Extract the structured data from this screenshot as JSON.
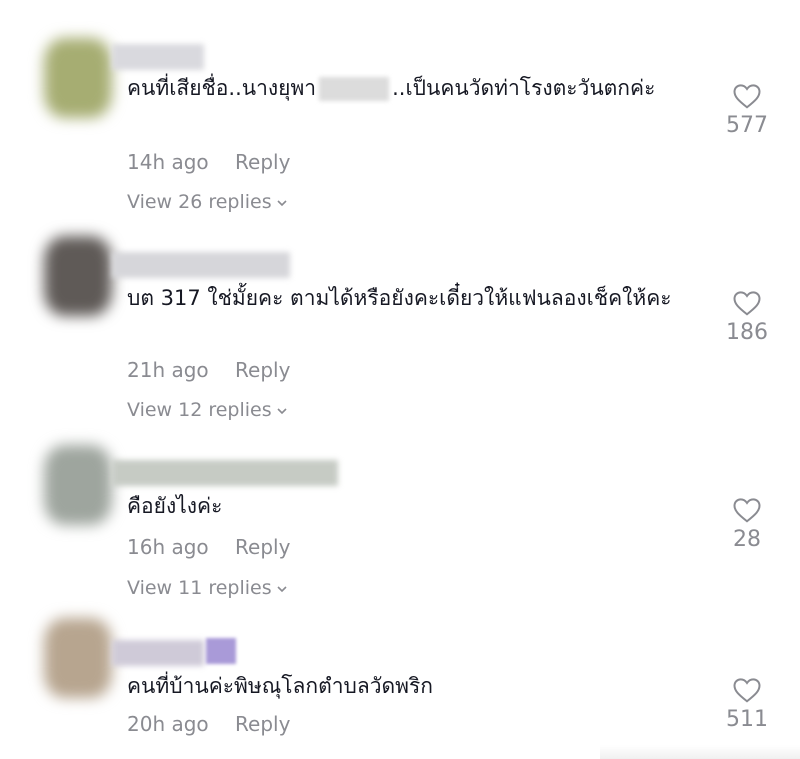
{
  "comments": [
    {
      "text_before": "คนที่เสียชื่อ..นางยุพา",
      "text_after": "..เป็นคนวัดท่าโรงตะวันตกค่ะ",
      "time": "14h ago",
      "reply_label": "Reply",
      "view_replies": "View 26 replies",
      "likes": "577",
      "avatar_color": "#a6ad72",
      "name_color": "#d9d9de"
    },
    {
      "text": "บต 317 ใช่มั้ยคะ ตามได้หรือยังคะเดี๋ยวให้แฟนลองเช็คให้คะ",
      "time": "21h ago",
      "reply_label": "Reply",
      "view_replies": "View 12 replies",
      "likes": "186",
      "avatar_color": "#5f5a57",
      "name_color": "#d6d6da"
    },
    {
      "text": "คือยังไงค่ะ",
      "time": "16h ago",
      "reply_label": "Reply",
      "view_replies": "View 11 replies",
      "likes": "28",
      "avatar_color": "#9ea59e",
      "name_color": "#c6cbc4"
    },
    {
      "text": "คนที่บ้านค่ะพิษณุโลกตำบลวัดพริก",
      "time": "20h ago",
      "reply_label": "Reply",
      "likes": "511",
      "avatar_color": "#b7a58f",
      "name_color": "#cfcad8",
      "name_accent": "#a99ad8"
    }
  ]
}
